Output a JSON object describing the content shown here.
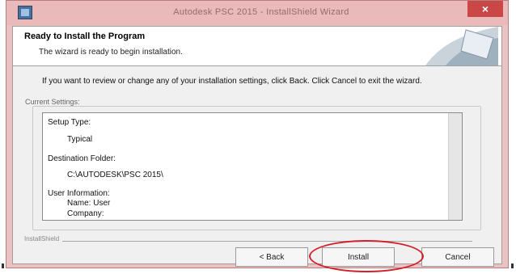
{
  "window": {
    "title": "Autodesk PSC 2015 - InstallShield Wizard",
    "close_label": "×"
  },
  "banner": {
    "title": "Ready to Install the Program",
    "subtitle": "The wizard is ready to begin installation."
  },
  "intro_text": "If you want to review or change any of your installation settings, click Back. Click Cancel to exit the wizard.",
  "settings": {
    "caption": "Current Settings:",
    "setup_type_label": "Setup Type:",
    "setup_type_value": "Typical",
    "destination_label": "Destination Folder:",
    "destination_value": "C:\\AUTODESK\\PSC 2015\\",
    "user_info_label": "User Information:",
    "user_name": "Name: User",
    "company": "Company:"
  },
  "footer": {
    "caption": "InstallShield"
  },
  "buttons": {
    "back": "< Back",
    "install": "Install",
    "cancel": "Cancel"
  },
  "colors": {
    "highlight": "#d21f2a",
    "titlebar": "#eab9b9",
    "close": "#c94747"
  }
}
